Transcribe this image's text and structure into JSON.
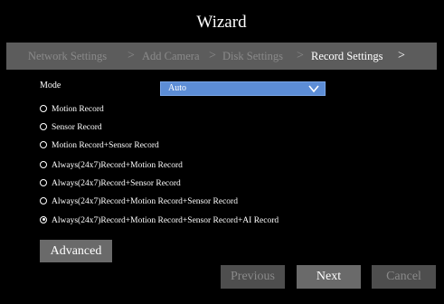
{
  "window": {
    "title": "Wizard"
  },
  "steps": [
    {
      "label": "Network Settings",
      "active": false
    },
    {
      "label": "Add Camera",
      "active": false
    },
    {
      "label": "Disk Settings",
      "active": false
    },
    {
      "label": "Record Settings",
      "active": true
    }
  ],
  "step_separator": ">",
  "mode": {
    "label": "Mode",
    "value": "Auto"
  },
  "record_options": [
    {
      "label": "Motion Record",
      "checked": false
    },
    {
      "label": "Sensor Record",
      "checked": false
    },
    {
      "label": "Motion Record+Sensor Record",
      "checked": false
    },
    {
      "label": "Always(24x7)Record+Motion Record",
      "checked": false
    },
    {
      "label": "Always(24x7)Record+Sensor Record",
      "checked": false
    },
    {
      "label": "Always(24x7)Record+Motion Record+Sensor Record",
      "checked": false
    },
    {
      "label": "Always(24x7)Record+Motion  Record+Sensor Record+AI  Record",
      "checked": true
    }
  ],
  "buttons": {
    "advanced": "Advanced",
    "previous": "Previous",
    "next": "Next",
    "cancel": "Cancel"
  }
}
